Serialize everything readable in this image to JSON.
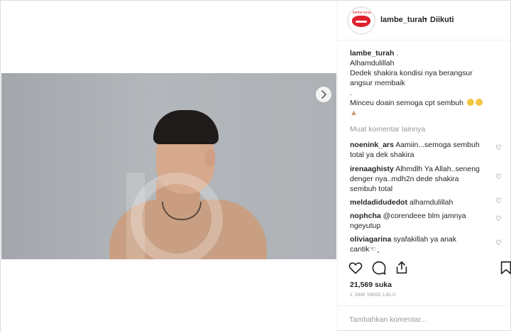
{
  "header": {
    "avatar_text": "lambe turah",
    "username": "lambe_turah",
    "separator": "•",
    "follow_status": "Diikuti"
  },
  "caption": {
    "username": "lambe_turah",
    "suffix": " .",
    "line1": "Alhamdulillah",
    "line2": "Dedek shakira kondisi nya berangsur",
    "line3": "angsur membaik",
    "line4": ".",
    "line5": "Minceu doain semoga cpt sembuh"
  },
  "more_comments_label": "Muat komentar lainnya",
  "comments": [
    {
      "user": "noenink_ars",
      "text1": " Aamiin...semoga sembuh",
      "text2": "total ya dek shakira",
      "text3": ""
    },
    {
      "user": "irenaaghisty",
      "text1": " Alhmdlh Ya Allah..seneng",
      "text2": "denger nya..mdh2n dede shakira",
      "text3": "sembuh total"
    },
    {
      "user": "meldadidudedot",
      "text1": " alhamdulillah",
      "text2": "",
      "text3": ""
    },
    {
      "user": "nophcha",
      "text1": " @corendeee blm jamnya",
      "text2": "ngeyutup",
      "text3": ""
    },
    {
      "user": "oliviagarina",
      "text1": " syafakillah ya anak",
      "text2": "cantik☜ ̥",
      "text3": ""
    }
  ],
  "likes": "21,569 suka",
  "timestamp": "1 JAM YANG LALU",
  "add_comment_placeholder": "Tambahkan komentar...",
  "icons": {
    "next": "chevron-right-icon",
    "like": "heart-icon",
    "comment": "comment-icon",
    "share": "share-icon",
    "save": "bookmark-icon"
  },
  "colors": {
    "border": "#dbdbdb",
    "muted": "#999999",
    "text": "#262626",
    "brand_red": "#e0202c"
  }
}
